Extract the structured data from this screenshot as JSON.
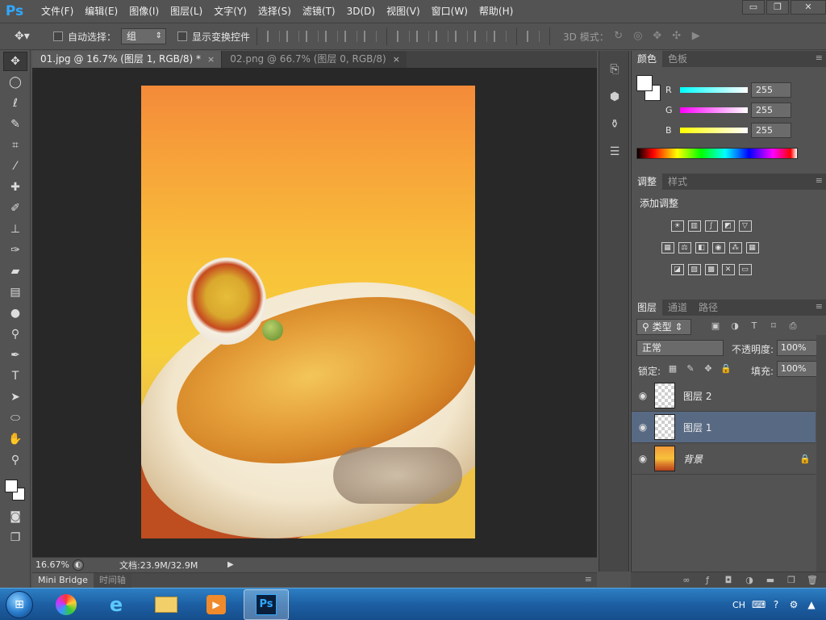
{
  "app": {
    "logo": "Ps",
    "menu": [
      "文件(F)",
      "编辑(E)",
      "图像(I)",
      "图层(L)",
      "文字(Y)",
      "选择(S)",
      "滤镜(T)",
      "3D(D)",
      "视图(V)",
      "窗口(W)",
      "帮助(H)"
    ],
    "window_controls": {
      "minimize": "▭",
      "restore": "❐",
      "close": "✕"
    }
  },
  "options_bar": {
    "auto_select_label": "自动选择：",
    "auto_select_value": "组",
    "show_transform_label": "显示变换控件",
    "threed_mode_label": "3D 模式："
  },
  "documents": {
    "tabs": [
      {
        "label": "01.jpg @ 16.7% (图层 1, RGB/8) *",
        "active": true
      },
      {
        "label": "02.png @ 66.7% (图层 0, RGB/8)",
        "active": false
      }
    ],
    "close_glyph": "×"
  },
  "status": {
    "zoom": "16.67%",
    "doc_size": "文档:23.9M/32.9M"
  },
  "bottom_tabs": [
    "Mini Bridge",
    "时间轴"
  ],
  "color_panel": {
    "tabs": [
      "颜色",
      "色板"
    ],
    "r": {
      "label": "R",
      "value": "255",
      "color": "#00ffff"
    },
    "g": {
      "label": "G",
      "value": "255",
      "color": "#ff00ff"
    },
    "b": {
      "label": "B",
      "value": "255",
      "color": "#ffff00"
    }
  },
  "adjustments_panel": {
    "tabs": [
      "调整",
      "样式"
    ],
    "title": "添加调整"
  },
  "layers_panel": {
    "tabs": [
      "图层",
      "通道",
      "路径"
    ],
    "filter_label": "类型",
    "blend_mode": "正常",
    "opacity_label": "不透明度:",
    "opacity_value": "100%",
    "lock_label": "锁定:",
    "fill_label": "填充:",
    "fill_value": "100%",
    "layers": [
      {
        "name": "图层 2",
        "selected": false,
        "thumb": "transparent"
      },
      {
        "name": "图层 1",
        "selected": true,
        "thumb": "transparent"
      },
      {
        "name": "背景",
        "selected": false,
        "thumb": "image",
        "locked": true
      }
    ]
  },
  "taskbar": {
    "language": "CH",
    "apps": [
      "windows-start",
      "color-app",
      "internet-explorer",
      "file-explorer",
      "media-player",
      "photoshop"
    ]
  }
}
